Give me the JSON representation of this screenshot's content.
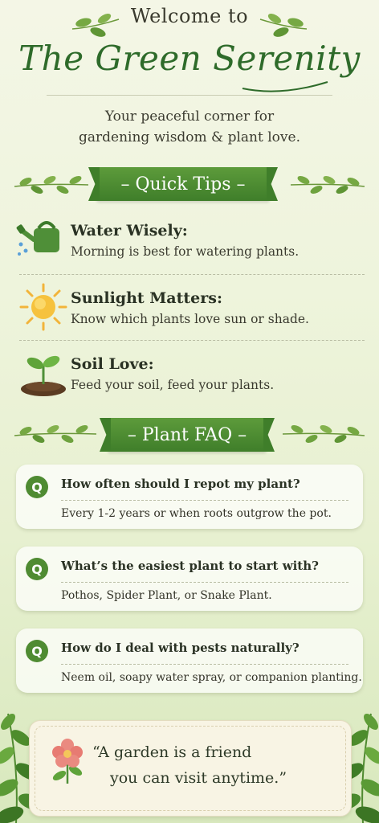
{
  "header": {
    "welcome": "Welcome to",
    "title": "The Green Serenity",
    "subtitle_line1": "Your peaceful corner for",
    "subtitle_line2": "gardening wisdom & plant love."
  },
  "quick_tips": {
    "banner": "– Quick Tips –",
    "items": [
      {
        "icon": "watering-can-icon",
        "title": "Water Wisely:",
        "desc": "Morning is best for watering plants."
      },
      {
        "icon": "sun-icon",
        "title": "Sunlight Matters:",
        "desc": "Know which plants love sun or shade."
      },
      {
        "icon": "sprout-icon",
        "title": "Soil Love:",
        "desc": "Feed your soil, feed your plants."
      }
    ]
  },
  "faq": {
    "banner": "– Plant FAQ –",
    "badge": "Q",
    "items": [
      {
        "q": "How often should I repot my plant?",
        "a": "Every 1-2 years or when roots outgrow the pot."
      },
      {
        "q": "What’s the easiest plant to start with?",
        "a": "Pothos, Spider Plant, or Snake Plant."
      },
      {
        "q": "How do I deal with pests naturally?",
        "a": "Neem oil, soapy water spray, or companion planting."
      }
    ]
  },
  "quote": {
    "line1": "“A garden is a friend",
    "line2": "you can visit anytime.”",
    "icon": "flower-icon"
  },
  "colors": {
    "accent_green": "#3f7e2a",
    "title_green": "#2e6b2a",
    "background": "#eef4dc"
  }
}
